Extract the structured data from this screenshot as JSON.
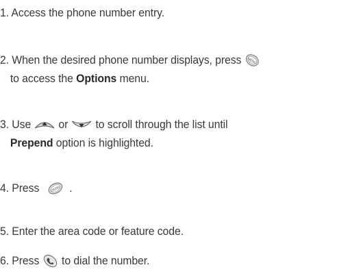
{
  "steps": [
    {
      "number": "1.",
      "text": "Access the phone number entry."
    },
    {
      "number": "2.",
      "text_before": "When the desired phone number displays, press",
      "icon": "menu-key-icon",
      "icon_label": "MENU",
      "line2_before": "to access the",
      "bold": "Options",
      "line2_after": "menu."
    },
    {
      "number": "3.",
      "text_before": "Use",
      "icon_up": "navigation-up-key-icon",
      "middle": "or",
      "icon_down": "navigation-down-key-icon",
      "text_after": "to scroll through the list until",
      "bold": "Prepend",
      "line2_after": "option is highlighted."
    },
    {
      "number": "4.",
      "text_before": "Press",
      "icon": "ok-key-icon",
      "icon_label": "OK/SEL",
      "text_after": "."
    },
    {
      "number": "5.",
      "text": "Enter the area code or feature code."
    },
    {
      "number": "6.",
      "text_before": "Press",
      "icon": "send-key-icon",
      "text_after": "to dial the number."
    }
  ]
}
